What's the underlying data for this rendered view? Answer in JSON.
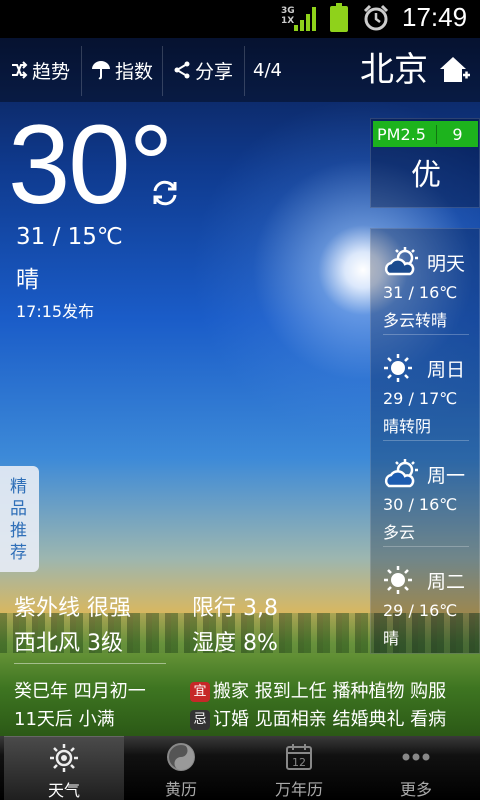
{
  "status_bar": {
    "network": "3G\n1X",
    "time": "17:49"
  },
  "toolbar": {
    "trend_label": "趋势",
    "index_label": "指数",
    "share_label": "分享",
    "page_indicator": "4/4"
  },
  "city": "北京",
  "current": {
    "temperature": "30°",
    "range": "31  /  15℃",
    "condition": "晴",
    "published": "17:15发布",
    "uv": "紫外线 很强",
    "restriction": "限行 3,8",
    "wind": "西北风 3级",
    "humidity": "湿度 8%"
  },
  "air_quality": {
    "label": "PM2.5",
    "value": "9",
    "quality": "优"
  },
  "forecast": [
    {
      "day": "明天",
      "temp": "31  /  16℃",
      "desc": "多云转晴",
      "icon": "partly-cloudy-icon"
    },
    {
      "day": "周日",
      "temp": "29  /  17℃",
      "desc": "晴转阴",
      "icon": "sun-icon"
    },
    {
      "day": "周一",
      "temp": "30  /  16℃",
      "desc": "多云",
      "icon": "partly-cloudy-icon"
    },
    {
      "day": "周二",
      "temp": "29  /  16℃",
      "desc": "晴",
      "icon": "sun-icon"
    }
  ],
  "side_tab": "精品推荐",
  "almanac": {
    "lunar_date": "癸巳年 四月初一",
    "solar_term": "11天后  小满",
    "good_badge": "宜",
    "good": "搬家 报到上任 播种植物 购服",
    "bad_badge": "忌",
    "bad": "订婚 见面相亲 结婚典礼 看病"
  },
  "tabs": [
    {
      "label": "天气",
      "icon": "sun-icon"
    },
    {
      "label": "黄历",
      "icon": "yin-yang-icon"
    },
    {
      "label": "万年历",
      "icon": "calendar-icon"
    },
    {
      "label": "更多",
      "icon": "more-icon"
    }
  ],
  "colors": {
    "pm_green": "#1db31d",
    "signal_green": "#8fd21b",
    "good_red": "#c62828",
    "side_tab_blue": "#2f6fb8"
  }
}
